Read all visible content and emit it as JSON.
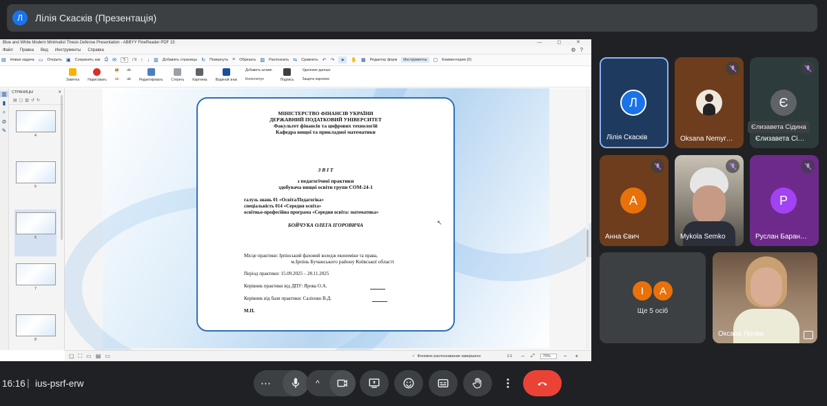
{
  "meeting": {
    "presenter_initial": "Л",
    "presenter_title": "Лілія Скасків (Презентація)",
    "time": "16:16",
    "separator": "|",
    "code": "ius-psrf-erw"
  },
  "app": {
    "window_title": "Blue and White Modern Minimalist Thesis Defense Presentation - ABBYY FineReader PDF 15",
    "window_controls": "— ◻ ✕",
    "menu": [
      "Файл",
      "Правка",
      "Вид",
      "Инструменты",
      "Справка"
    ],
    "toolbar": {
      "new_task": "Новая задача",
      "open": "Открыть",
      "save_as": "Сохранить как",
      "page_current": "5",
      "page_total": "/ 9",
      "add_pages": "Добавить страницы",
      "rotate": "Повернуть",
      "crop": "Обрезать",
      "recognize": "Распознать",
      "compare": "Сравнить",
      "form_editor": "Редактор форм",
      "tools": "Инструменты",
      "comments": "Комментарии (0)"
    },
    "ribbon": {
      "note": "Заметка",
      "draw": "Нарисовать",
      "edit": "Редактировать",
      "erase": "Стереть",
      "picture": "Картинка",
      "watermark": "Водяной знак",
      "add_stamp": "Добавить штамп",
      "header_footer": "Колонтитул",
      "sign": "Подпись",
      "delete_data": "Удаление данных",
      "password": "Защита паролем"
    },
    "pages_panel": {
      "title": "СТРАНИЦЫ",
      "close": "✕",
      "thumbs": [
        "4",
        "5",
        "6",
        "7",
        "8"
      ]
    },
    "status": {
      "bg_recognition": "Фоновое распознавание завершено",
      "ratio": "1:1",
      "zoom": "75%"
    }
  },
  "doc": {
    "h1": "МІНІСТЕРСТВО ФІНАНСІВ УКРАЇНИ",
    "h2": "ДЕРЖАВНИЙ ПОДАТКОВИЙ УНІВЕРСИТЕТ",
    "h3": "Факультет фінансів та цифрових технологій",
    "h4": "Кафедра вищої та прикладної математики",
    "report": "З В І Т",
    "practice": "з педагогічної практики",
    "group": "здобувача вищої освіти групи СОМ-24-1",
    "field": "галузь знань 01 «Освіта/Педагогіка»",
    "spec": "спеціальність 014 «Середня освіта»",
    "program": "освітньо-професійна програма «Середня освіта: математика»",
    "student": "БОЙЧУКА ОЛЕГА ІГОРОВИЧА",
    "place_1": "Місце практики: Ірпінський фаховий коледж економіки та права,",
    "place_2": "м.Ірпінь Бучанського району Київської області",
    "period": "Період практики: 15.09.2025 – 28.11.2025",
    "sup_dpu": "Керівник практики від ДПУ: Ярова О.А.",
    "sup_base": "Керівник від бази практики: Салієнко В.Д.",
    "mp": "М.П."
  },
  "participants": [
    {
      "name": "Лілія Скаскiв",
      "initial": "Л"
    },
    {
      "name": "Oksana Nemyr…"
    },
    {
      "name": "Єлизавета Сі…",
      "initial": "Є"
    },
    {
      "name": "Анна Євич",
      "initial": "А"
    },
    {
      "name": "Mykola Semko"
    },
    {
      "name": "Руслан Баран…",
      "initial": "Р"
    },
    {
      "more": "Ще 5 осіб",
      "i1": "І",
      "i2": "А"
    },
    {
      "name": "Оксана Ярова"
    }
  ],
  "tooltip": "Єлизавета Сідина",
  "controls": {
    "more": "⋯",
    "caret": "^"
  },
  "colors": {
    "tile_brown": "#6d3d1d",
    "tile_dark": "#2d3b3c",
    "tile_purple": "#6e2a8a",
    "avatar_blue": "#1a73e8",
    "avatar_orange": "#e8710a",
    "avatar_purple": "#a142f4",
    "end_call": "#ea4335"
  }
}
